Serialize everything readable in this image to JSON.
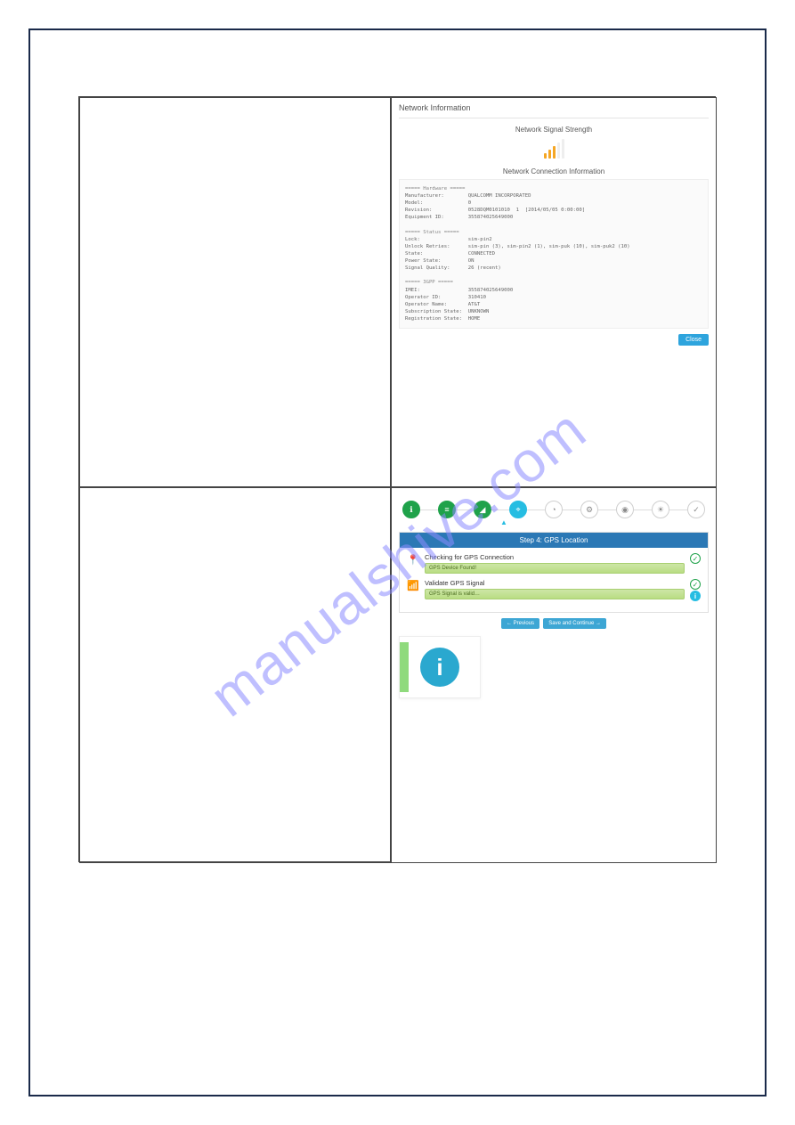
{
  "watermark": "manualshive.com",
  "network_info": {
    "title": "Network Information",
    "signal_heading": "Network Signal Strength",
    "connection_heading": "Network Connection Information",
    "signal_bars_on": 3,
    "signal_bars_total": 5,
    "sections": {
      "hardware_header": "===== Hardware =====",
      "hardware": {
        "Manufacturer": "QUALCOMM INCORPORATED",
        "Model": "0",
        "Revision": "0528DQM0101010  1  [2014/05/05 0:00:00]",
        "Equipment ID": "355874025649000"
      },
      "status_header": "===== Status =====",
      "status": {
        "Lock": "sim-pin2",
        "Unlock Retries": "sim-pin (3), sim-pin2 (1), sim-puk (10), sim-puk2 (10)",
        "State": "CONNECTED",
        "Power State": "ON",
        "Signal Quality": "26 (recent)"
      },
      "gpp_header": "===== 3GPP =====",
      "gpp": {
        "IMEI": "355874025649000",
        "Operator ID": "310410",
        "Operator Name": "AT&T",
        "Subscription State": "UNKNOWN",
        "Registration State": "HOME"
      }
    },
    "close_label": "Close"
  },
  "gps_step": {
    "nav_icons": [
      "ℹ",
      "≡",
      "◢",
      "⌖",
      "◔",
      "⚙",
      "◉",
      "☀",
      "✓"
    ],
    "nav_done_count": 3,
    "nav_active_index": 3,
    "panel_title": "Step 4: GPS Location",
    "rows": [
      {
        "icon": "loc",
        "label": "Checking for GPS Connection",
        "bar_text": "GPS Device Found!",
        "checks": [
          "check"
        ]
      },
      {
        "icon": "sig",
        "label": "Validate GPS Signal",
        "bar_text": "GPS Signal is valid…",
        "checks": [
          "check",
          "info"
        ]
      }
    ],
    "buttons": {
      "prev": "← Previous",
      "next": "Save and Continue →"
    },
    "info_glyph": "i"
  }
}
